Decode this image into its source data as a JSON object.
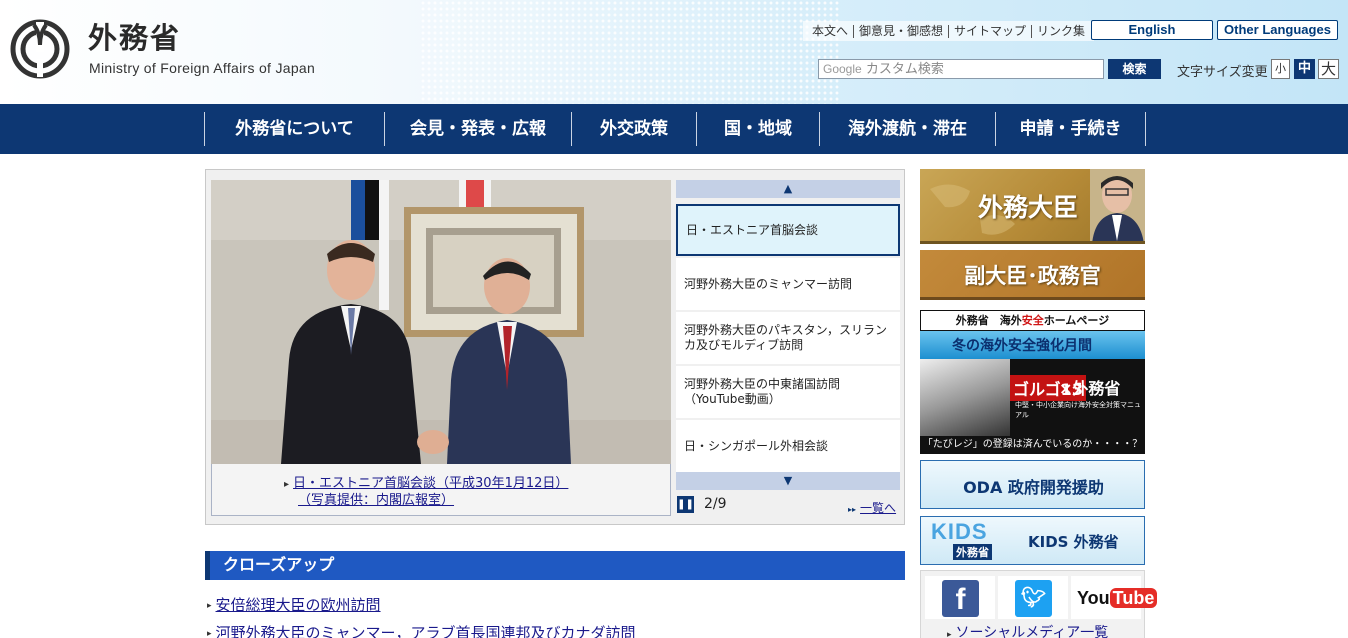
{
  "header": {
    "logo_ja": "外務省",
    "logo_en": "Ministry of Foreign Affairs of Japan",
    "util_links": [
      "本文へ",
      "御意見・御感想",
      "サイトマップ",
      "リンク集"
    ],
    "lang_english": "English",
    "lang_other": "Other Languages",
    "search_brand": "Google",
    "search_placeholder": "カスタム検索",
    "search_button": "検索",
    "font_size_label": "文字サイズ変更",
    "font_small": "小",
    "font_medium": "中",
    "font_large": "大"
  },
  "nav": [
    "外務省について",
    "会見・発表・広報",
    "外交政策",
    "国・地域",
    "海外渡航・滞在",
    "申請・手続き"
  ],
  "slider": {
    "caption_line1": "日・エストニア首脳会談（平成30年1月12日）",
    "caption_line2": "（写真提供：内閣広報室）",
    "items": [
      "日・エストニア首脳会談",
      "河野外務大臣のミャンマー訪問",
      "河野外務大臣のパキスタン，スリランカ及びモルディブ訪問",
      "河野外務大臣の中東諸国訪問（YouTube動画）",
      "日・シンガポール外相会談"
    ],
    "counter": "2/9",
    "list_link": "一覧へ"
  },
  "closeup": {
    "heading": "クローズアップ",
    "links": [
      "安倍総理大臣の欧州訪問",
      "河野外務大臣のミャンマー，アラブ首長国連邦及びカナダ訪問"
    ]
  },
  "sidebar": {
    "minister": "外務大臣",
    "vice": "副大臣･政務官",
    "safety_top_prefix": "外務省　海外",
    "safety_top_red": "安全",
    "safety_top_suffix": "ホームページ",
    "safety_month": "冬の海外安全強化月間",
    "golgo_title": "ゴルゴ13",
    "golgo_title2": "×外務省",
    "golgo_sub": "中堅・中小企業向け海外安全対策マニュアル",
    "safety_bottom": "「たびレジ」の登録は済んでいるのか・・・・？",
    "oda": "ODA 政府開発援助",
    "kids_logo": "KIDS",
    "kids_logo2": "外務省",
    "kids": "KIDS 外務省",
    "social_link": "ソーシャルメディア一覧"
  },
  "colors": {
    "navy": "#0d3773",
    "closeup_blue": "#1f59c2",
    "minister_gold": "#b58a37"
  },
  "icons": [
    "mofa-logo-icon",
    "slider-up-icon",
    "slider-down-icon",
    "pause-icon",
    "facebook-icon",
    "twitter-icon",
    "youtube-icon"
  ]
}
